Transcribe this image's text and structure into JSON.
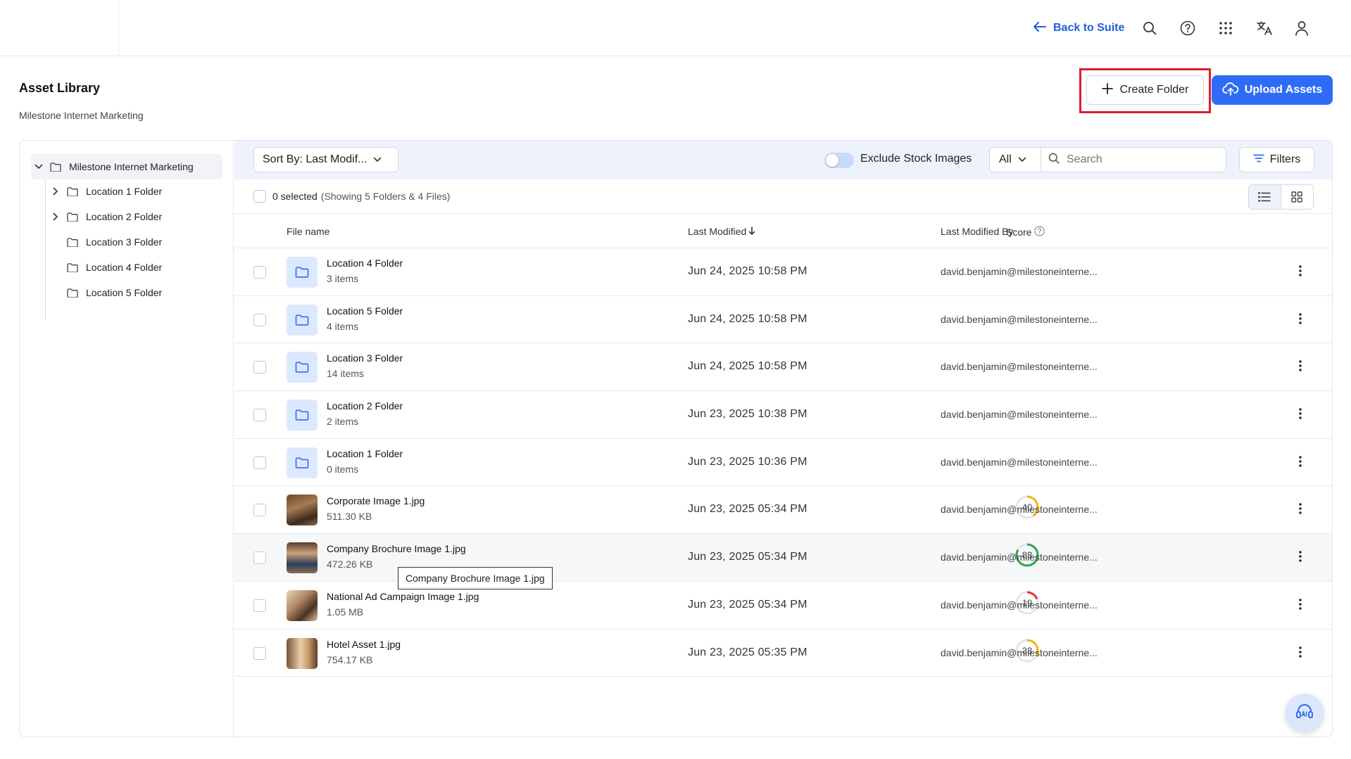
{
  "header": {
    "back_label": "Back to Suite",
    "icons": [
      "search-icon",
      "help-icon",
      "apps-grid-icon",
      "translate-icon",
      "user-icon"
    ]
  },
  "page": {
    "title": "Asset Library",
    "subtitle": "Milestone Internet Marketing",
    "create_folder_label": "Create Folder",
    "upload_label": "Upload Assets"
  },
  "sidebar": {
    "root": "Milestone Internet Marketing",
    "items": [
      {
        "label": "Location 1 Folder",
        "expandable": true
      },
      {
        "label": "Location 2 Folder",
        "expandable": true
      },
      {
        "label": "Location 3 Folder",
        "expandable": false
      },
      {
        "label": "Location 4 Folder",
        "expandable": false
      },
      {
        "label": "Location 5 Folder",
        "expandable": false
      }
    ]
  },
  "toolbar": {
    "sort_label": "Sort By: Last Modif...",
    "exclude_stock_label": "Exclude Stock Images",
    "exclude_stock_on": false,
    "type_filter": "All",
    "search_placeholder": "Search",
    "filters_label": "Filters"
  },
  "selection": {
    "count_text": "0 selected",
    "showing_text": "(Showing 5 Folders & 4 Files)"
  },
  "table": {
    "columns": {
      "file_name": "File name",
      "last_modified": "Last Modified",
      "score": "Score",
      "last_modified_by": "Last Modified By"
    },
    "rows": [
      {
        "name": "Location 4 Folder",
        "meta": "3 items",
        "date": "Jun 24, 2025 10:58 PM",
        "by": "david.benjamin@milestoneinterne...",
        "type": "folder"
      },
      {
        "name": "Location 5 Folder",
        "meta": "4 items",
        "date": "Jun 24, 2025 10:58 PM",
        "by": "david.benjamin@milestoneinterne...",
        "type": "folder"
      },
      {
        "name": "Location 3 Folder",
        "meta": "14 items",
        "date": "Jun 24, 2025 10:58 PM",
        "by": "david.benjamin@milestoneinterne...",
        "type": "folder"
      },
      {
        "name": "Location 2 Folder",
        "meta": "2 items",
        "date": "Jun 23, 2025 10:38 PM",
        "by": "david.benjamin@milestoneinterne...",
        "type": "folder"
      },
      {
        "name": "Location 1 Folder",
        "meta": "0 items",
        "date": "Jun 23, 2025 10:36 PM",
        "by": "david.benjamin@milestoneinterne...",
        "type": "folder"
      },
      {
        "name": "Corporate Image 1.jpg",
        "meta": "511.30 KB",
        "date": "Jun 23, 2025 05:34 PM",
        "by": "david.benjamin@milestoneinterne...",
        "type": "image",
        "score": "40",
        "score_color": "#f2b705",
        "score_fraction": 0.4
      },
      {
        "name": "Company Brochure Image 1.jpg",
        "meta": "472.26 KB",
        "date": "Jun 23, 2025 05:34 PM",
        "by": "david.benjamin@milestoneinterne...",
        "type": "image",
        "score": "83",
        "score_color": "#2ea44f",
        "score_fraction": 0.83
      },
      {
        "name": "National Ad Campaign Image 1.jpg",
        "meta": "1.05 MB",
        "date": "Jun 23, 2025 05:34 PM",
        "by": "david.benjamin@milestoneinterne...",
        "type": "image",
        "score": "19",
        "score_color": "#e5322d",
        "score_fraction": 0.19
      },
      {
        "name": "Hotel Asset 1.jpg",
        "meta": "754.17 KB",
        "date": "Jun 23, 2025 05:35 PM",
        "by": "david.benjamin@milestoneinterne...",
        "type": "image",
        "score": "33",
        "score_color": "#f2b705",
        "score_fraction": 0.33
      }
    ]
  },
  "tooltip": "Company Brochure Image 1.jpg",
  "colors": {
    "accent": "#2f6cf6",
    "link": "#1f5fd6",
    "highlight": "#e01b2f"
  }
}
